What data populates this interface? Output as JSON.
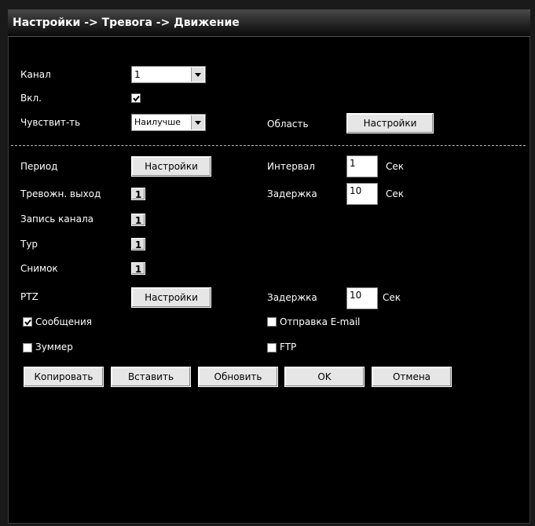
{
  "title": "Настройки -> Тревога -> Движение",
  "channel": {
    "label": "Канал",
    "value": "1"
  },
  "enabled": {
    "label": "Вкл.",
    "checked": true
  },
  "sensitivity": {
    "label": "Чувствит-ть",
    "value": "Наилучше"
  },
  "area": {
    "label": "Область",
    "button": "Настройки"
  },
  "period": {
    "label": "Период",
    "button": "Настройки"
  },
  "interval": {
    "label": "Интервал",
    "value": "1",
    "unit": "Сек"
  },
  "alarm_output": {
    "label": "Тревожн. выход",
    "value": "1"
  },
  "delay1": {
    "label": "Задержка",
    "value": "10",
    "unit": "Сек"
  },
  "record_channel": {
    "label": "Запись канала",
    "value": "1"
  },
  "tour": {
    "label": "Тур",
    "value": "1"
  },
  "snapshot": {
    "label": "Снимок",
    "value": "1"
  },
  "ptz": {
    "label": "PTZ",
    "button": "Настройки"
  },
  "delay2": {
    "label": "Задержка",
    "value": "10",
    "unit": "Сек"
  },
  "messages": {
    "label": "Сообщения",
    "checked": true
  },
  "email": {
    "label": "Отправка E-mail",
    "checked": false
  },
  "buzzer": {
    "label": "Зуммер",
    "checked": false
  },
  "ftp": {
    "label": "FTP",
    "checked": false
  },
  "actions": {
    "copy": "Копировать",
    "paste": "Вставить",
    "refresh": "Обновить",
    "ok": "OK",
    "cancel": "Отмена"
  }
}
